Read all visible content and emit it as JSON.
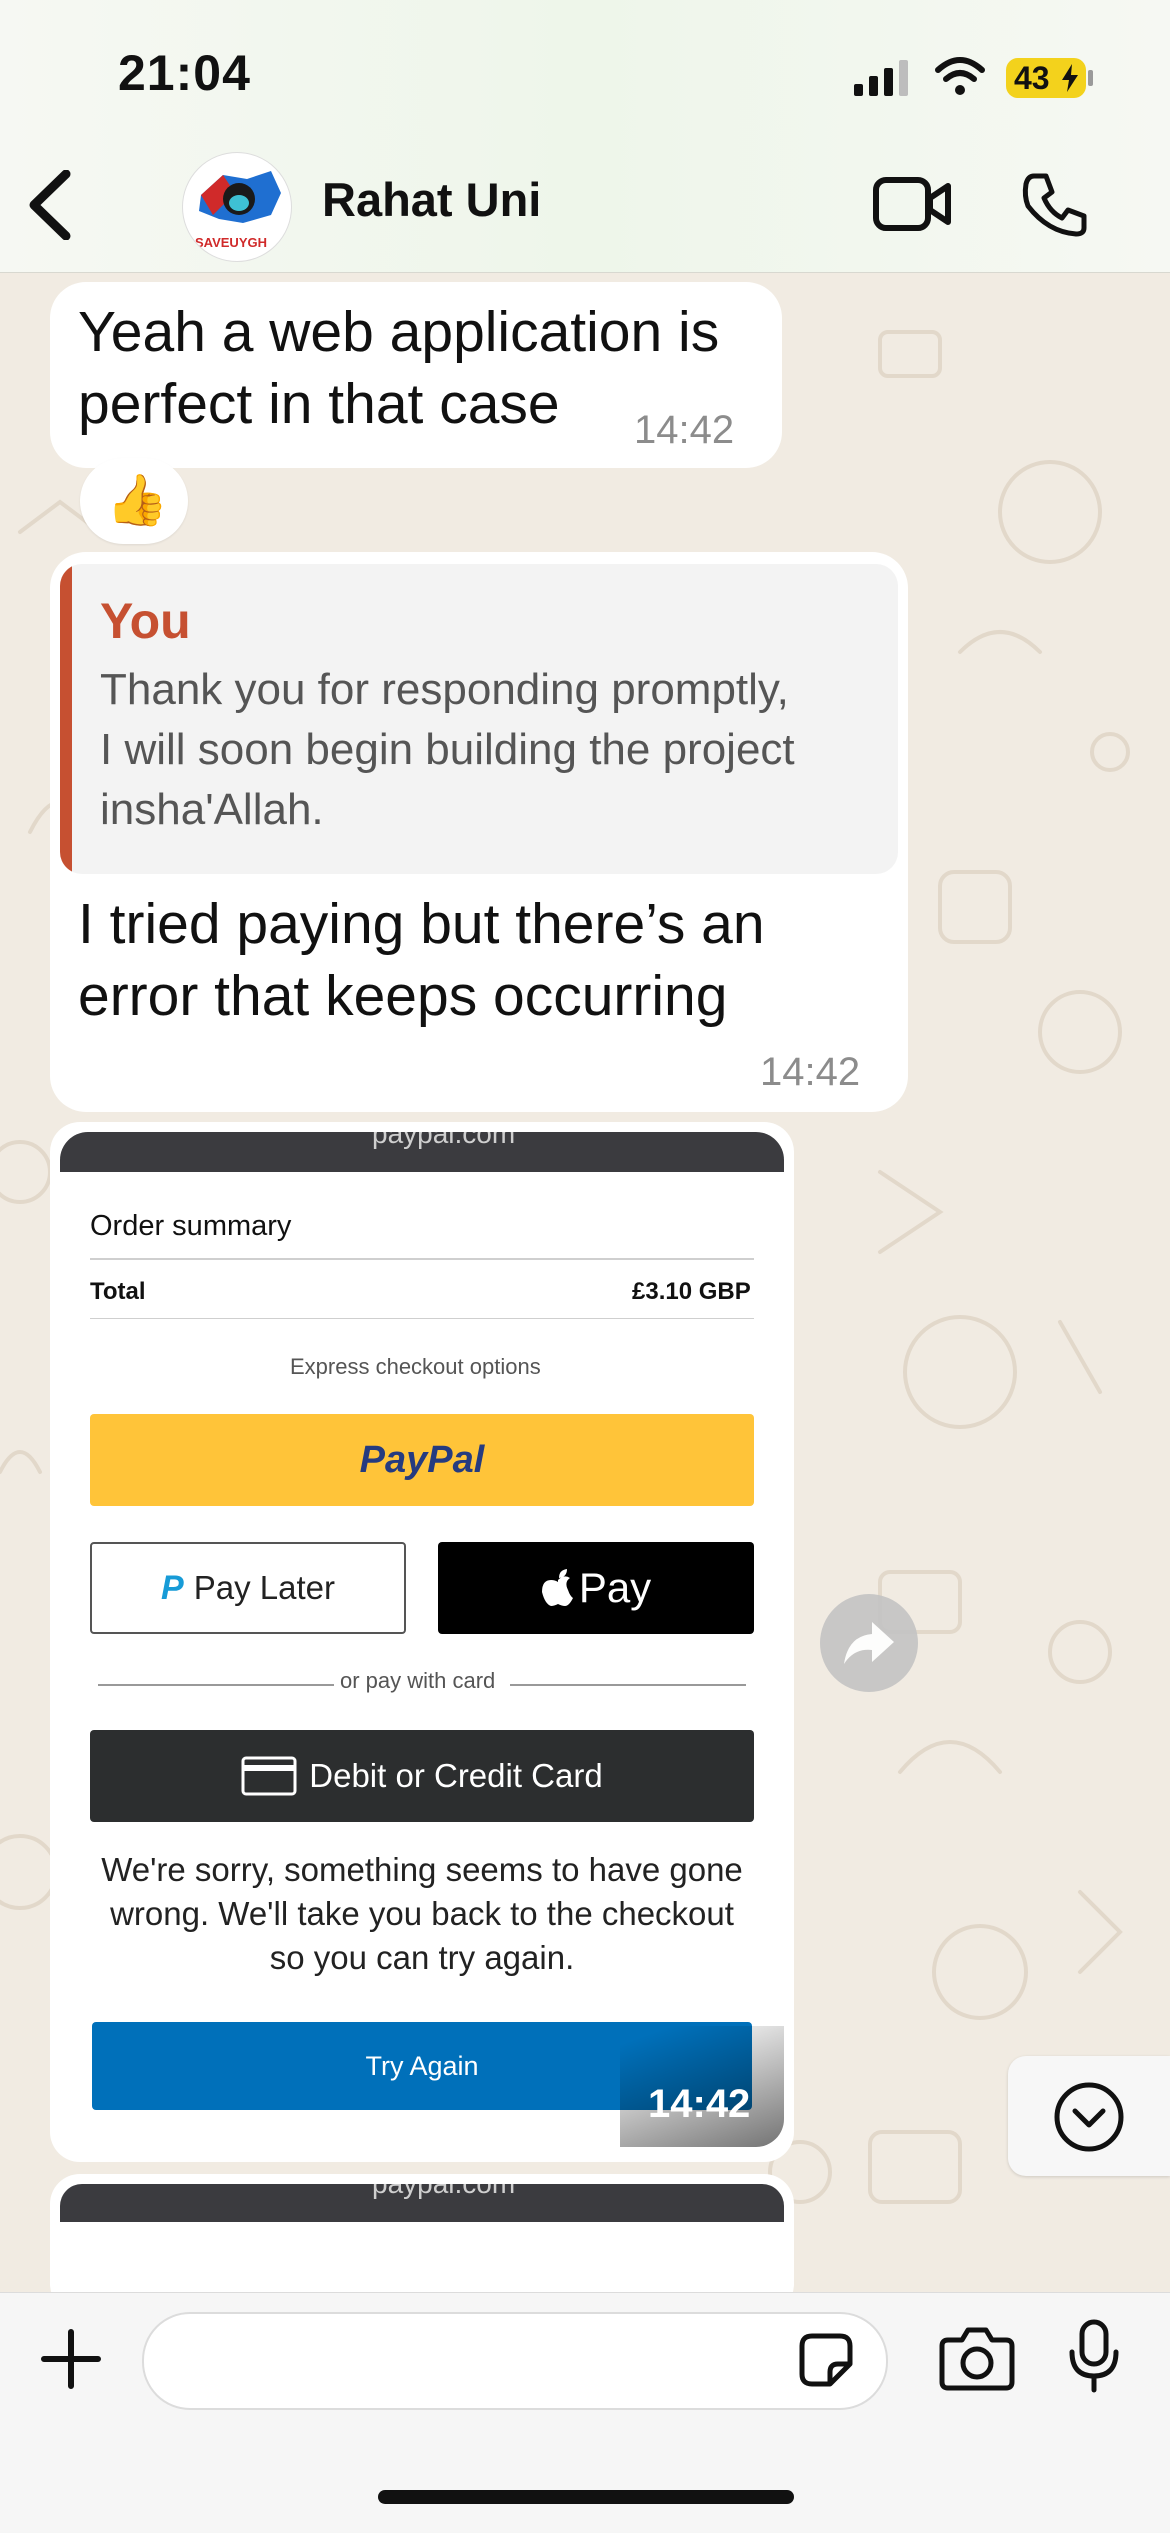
{
  "status_bar": {
    "time": "21:04",
    "battery_level": "43",
    "icons": [
      "cellular-signal-icon",
      "wifi-icon",
      "battery-charging-icon"
    ]
  },
  "header": {
    "contact_name": "Rahat Uni",
    "avatar_text": "SAVEUYGH",
    "icons": [
      "back-chevron-icon",
      "video-call-icon",
      "phone-call-icon"
    ]
  },
  "messages": [
    {
      "text_line1": "Yeah a web application is",
      "text_line2": "perfect in that case",
      "time": "14:42",
      "reaction": "👍"
    },
    {
      "quote_author": "You",
      "quote_line1": "Thank you for responding promptly,",
      "quote_line2": "I will soon begin building the project",
      "quote_line3": "insha'Allah.",
      "text_line1": "I tried paying but there’s an",
      "text_line2": "error that keeps occurring",
      "time": "14:42"
    },
    {
      "type": "image",
      "time": "14:42",
      "screenshot": {
        "top_bar_text": "paypal.com",
        "order_summary": "Order summary",
        "total_label": "Total",
        "total_value": "£3.10 GBP",
        "express_label": "Express checkout options",
        "paypal_button": "PayPal",
        "pay_later_button": "Pay Later",
        "apple_pay_button": "Pay",
        "divider_text": "or pay with card",
        "card_button": "Debit or Credit Card",
        "error_line1": "We're sorry, something seems to have gone",
        "error_line2": "wrong. We'll take you back to the checkout",
        "error_line3": "so you can try again.",
        "try_again_button": "Try Again"
      }
    },
    {
      "type": "image",
      "screenshot": {
        "top_bar_text": "paypal.com"
      }
    }
  ],
  "input_bar": {
    "placeholder": "",
    "icons": [
      "plus-icon",
      "sticker-icon",
      "camera-icon",
      "microphone-icon"
    ]
  },
  "colors": {
    "wallpaper": "#f1ebe2",
    "quote_accent": "#c65031",
    "paypal_yellow": "#ffc439",
    "paypal_blue": "#0070ba",
    "dark_button": "#2c2e2f"
  }
}
